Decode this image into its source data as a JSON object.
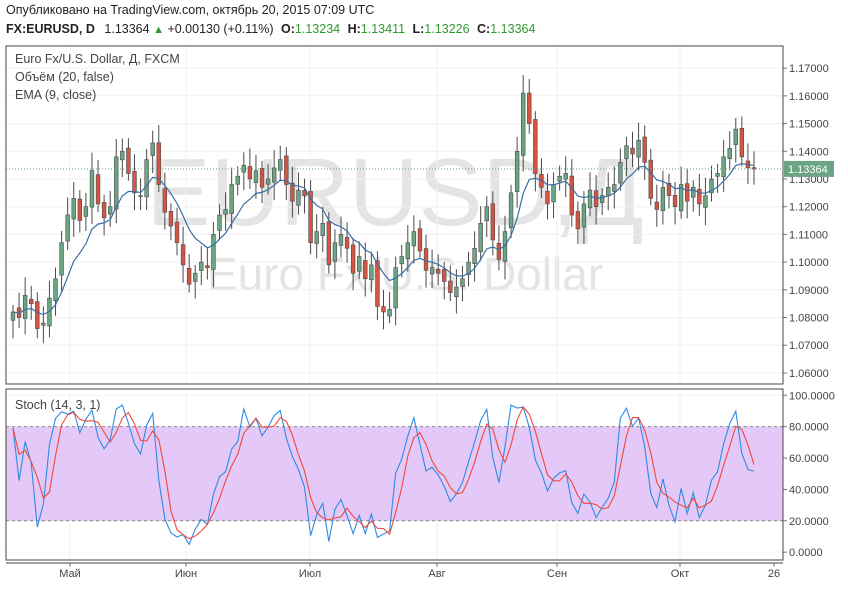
{
  "header": {
    "published": "Опубликовано на TradingView.com, октябрь 20, 2015 07:09 UTC",
    "symbol": "FX:EURUSD, D",
    "last": "1.13364",
    "change": "+0.00130 (+0.11%)",
    "o_label": "O:",
    "o_value": "1.13234",
    "h_label": "H:",
    "h_value": "1.13411",
    "l_label": "L:",
    "l_value": "1.13226",
    "c_label": "C:",
    "c_value": "1.13364"
  },
  "legend": {
    "title": "Euro Fx/U.S. Dollar, Д, FXCM",
    "volume": "Объём (20, false)",
    "ema": "EMA (9, close)"
  },
  "watermark": {
    "symbol": "EURUSD,Д",
    "name": "Euro Fx/U.S. Dollar"
  },
  "stoch_label": "Stoch (14, 3, 1)",
  "colors": {
    "up": "#6ba583",
    "down": "#d75442",
    "ema": "#3a6ea5",
    "stoch_k": "#2f8be0",
    "stoch_d": "#ef4a3c",
    "band": "#e3c8f8",
    "price_tag": "#6ba583"
  },
  "chart_data": [
    {
      "type": "candlestick",
      "title": "Euro Fx/U.S. Dollar, Д, FXCM",
      "x_ticks": [
        "Май",
        "Июн",
        "Июл",
        "Авг",
        "Сен",
        "Окт",
        "26"
      ],
      "y_ticks": [
        "1.17000",
        "1.16000",
        "1.15000",
        "1.14000",
        "1.13000",
        "1.12000",
        "1.11000",
        "1.10000",
        "1.09000",
        "1.08000",
        "1.07000",
        "1.06000"
      ],
      "ylim": [
        1.056,
        1.178
      ],
      "last_price": 1.13364,
      "last_price_label": "1.13364",
      "closes": [
        1.082,
        1.08,
        1.088,
        1.085,
        1.076,
        1.078,
        1.087,
        1.094,
        1.107,
        1.117,
        1.123,
        1.115,
        1.12,
        1.133,
        1.121,
        1.116,
        1.12,
        1.138,
        1.14,
        1.132,
        1.125,
        1.124,
        1.137,
        1.143,
        1.128,
        1.118,
        1.113,
        1.107,
        1.099,
        1.092,
        1.096,
        1.1,
        1.098,
        1.11,
        1.117,
        1.119,
        1.128,
        1.131,
        1.135,
        1.13,
        1.133,
        1.127,
        1.13,
        1.134,
        1.137,
        1.128,
        1.122,
        1.126,
        1.124,
        1.107,
        1.111,
        1.114,
        1.099,
        1.107,
        1.11,
        1.105,
        1.096,
        1.102,
        1.094,
        1.099,
        1.084,
        1.082,
        1.083,
        1.098,
        1.102,
        1.107,
        1.111,
        1.104,
        1.097,
        1.098,
        1.096,
        1.093,
        1.089,
        1.091,
        1.094,
        1.1,
        1.105,
        1.114,
        1.12,
        1.108,
        1.101,
        1.111,
        1.125,
        1.14,
        1.161,
        1.15,
        1.132,
        1.127,
        1.121,
        1.128,
        1.131,
        1.132,
        1.117,
        1.112,
        1.121,
        1.126,
        1.12,
        1.124,
        1.127,
        1.128,
        1.136,
        1.142,
        1.139,
        1.144,
        1.136,
        1.123,
        1.119,
        1.127,
        1.124,
        1.12,
        1.128,
        1.122,
        1.127,
        1.121,
        1.124,
        1.13,
        1.132,
        1.138,
        1.141,
        1.148,
        1.138,
        1.134,
        1.1336
      ],
      "ema_period": 9,
      "annotation": "1.13364"
    },
    {
      "type": "line",
      "title": "Stoch (14, 3, 1)",
      "y_ticks": [
        "100.0000",
        "80.0000",
        "60.0000",
        "40.0000",
        "20.0000",
        "0.0000"
      ],
      "ylim": [
        -5,
        104
      ],
      "band": [
        20,
        80
      ],
      "series": [
        {
          "name": "%K",
          "color": "#2f8be0"
        },
        {
          "name": "%D",
          "color": "#ef4a3c"
        }
      ]
    }
  ]
}
